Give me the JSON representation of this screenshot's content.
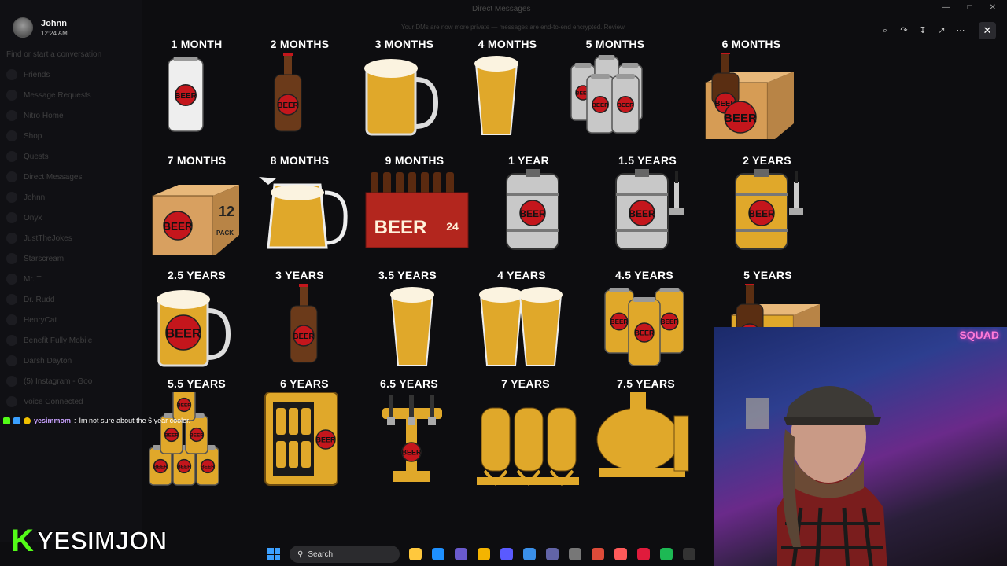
{
  "viewer": {
    "user_name": "Johnn",
    "timestamp": "12:24 AM",
    "title": "Direct Messages",
    "notice": "Your DMs are now more private — messages are end-to-end encrypted. Review",
    "tools": [
      "zoom-icon",
      "forward-icon",
      "download-icon",
      "open-external-icon",
      "more-icon"
    ]
  },
  "sidebar": {
    "search_placeholder": "Find or start a conversation",
    "items": [
      "Friends",
      "Message Requests",
      "Nitro Home",
      "Shop",
      "Quests",
      "Direct Messages",
      "Johnn",
      "Onyx",
      "JustTheJokes",
      "Starscream",
      "Mr. T",
      "Dr. Rudd",
      "HenryCat",
      "Benefit Fully Mobile",
      "Darsh Dayton",
      "(5) Instagram - Goo",
      "Voice Connected"
    ]
  },
  "grid": {
    "items": [
      {
        "label": "1 MONTH",
        "icon": "beer-can-icon"
      },
      {
        "label": "2 MONTHS",
        "icon": "beer-bottle-icon"
      },
      {
        "label": "3 MONTHS",
        "icon": "beer-mug-icon"
      },
      {
        "label": "4 MONTHS",
        "icon": "pint-glass-icon"
      },
      {
        "label": "5 MONTHS",
        "icon": "six-pack-cans-icon"
      },
      {
        "label": "6 MONTHS",
        "icon": "six-pack-bottles-icon"
      },
      {
        "label": "7 MONTHS",
        "icon": "twelve-pack-box-icon",
        "text": "BEER",
        "pack": "12 PACK"
      },
      {
        "label": "8 MONTHS",
        "icon": "beer-pitcher-icon"
      },
      {
        "label": "9 MONTHS",
        "icon": "twenty-four-pack-crate-icon",
        "text": "BEER",
        "pack": "24 PACK"
      },
      {
        "label": "1 YEAR",
        "icon": "keg-icon"
      },
      {
        "label": "1.5 YEARS",
        "icon": "keg-tap-icon"
      },
      {
        "label": "2 YEARS",
        "icon": "gold-keg-tap-icon"
      },
      {
        "label": "2.5 YEARS",
        "icon": "gold-mug-icon"
      },
      {
        "label": "3 YEARS",
        "icon": "gold-bottle-icon"
      },
      {
        "label": "3.5 YEARS",
        "icon": "gold-pint-icon"
      },
      {
        "label": "4 YEARS",
        "icon": "two-pints-icon"
      },
      {
        "label": "4.5 YEARS",
        "icon": "gold-cans-icon"
      },
      {
        "label": "5 YEARS",
        "icon": "gold-six-pack-icon"
      },
      {
        "label": "5.5 YEARS",
        "icon": "can-pyramid-icon"
      },
      {
        "label": "6 YEARS",
        "icon": "beer-cooler-icon"
      },
      {
        "label": "6.5 YEARS",
        "icon": "beer-tower-icon"
      },
      {
        "label": "7 YEARS",
        "icon": "brewing-tanks-icon"
      },
      {
        "label": "7.5 YEARS",
        "icon": "brew-kettle-icon"
      }
    ],
    "badge_text": "BEER"
  },
  "chat": {
    "user": "yesimmom",
    "message": "Im not sure about the 6 year cooler."
  },
  "brand": {
    "k": "K",
    "name": "YESIMJON"
  },
  "webcam": {
    "sign": "SQUAD"
  },
  "taskbar": {
    "search": "Search",
    "apps": [
      "file-explorer-icon",
      "edge-icon",
      "copilot-icon",
      "folder-icon",
      "store-icon",
      "mail-icon",
      "teams-icon",
      "app-icon",
      "chrome-icon",
      "maps-icon",
      "record-icon",
      "spotify-icon",
      "epic-icon"
    ]
  },
  "colors": {
    "accent": "#53fc18",
    "badge_red": "#c4161c",
    "gold": "#e0a82a",
    "silver": "#c8c8c8"
  }
}
